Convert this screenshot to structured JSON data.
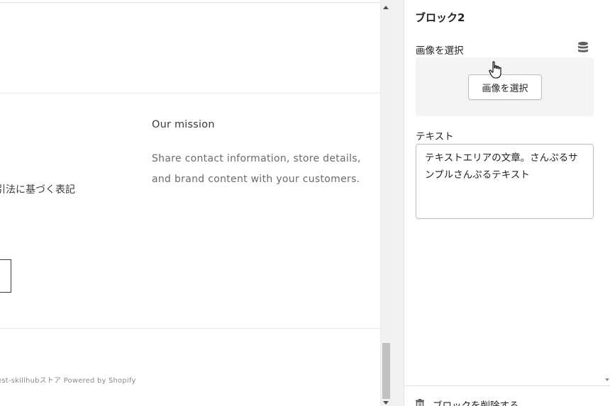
{
  "preview": {
    "mission_title": "Our mission",
    "mission_text": "Share contact information, store details, and brand content with your customers.",
    "legal_text": "引法に基づく表記",
    "footer_copyright": "est-skillhubストア Powered by Shopify"
  },
  "panel": {
    "title": "ブロック2",
    "image_label": "画像を選択",
    "image_button_label": "画像を選択",
    "text_label": "テキスト",
    "text_value": "テキストエリアの文章。さんぷるサンプルさんぷるテキスト",
    "delete_label": "ブロックを削除する"
  },
  "icons": {
    "database": "database-icon",
    "trash": "trash-icon",
    "cursor": "hand-cursor-icon"
  },
  "colors": {
    "panel_border": "#e1e3e5",
    "image_box_bg": "#f4f4f4",
    "scroll_thumb": "#c1c1c1"
  }
}
